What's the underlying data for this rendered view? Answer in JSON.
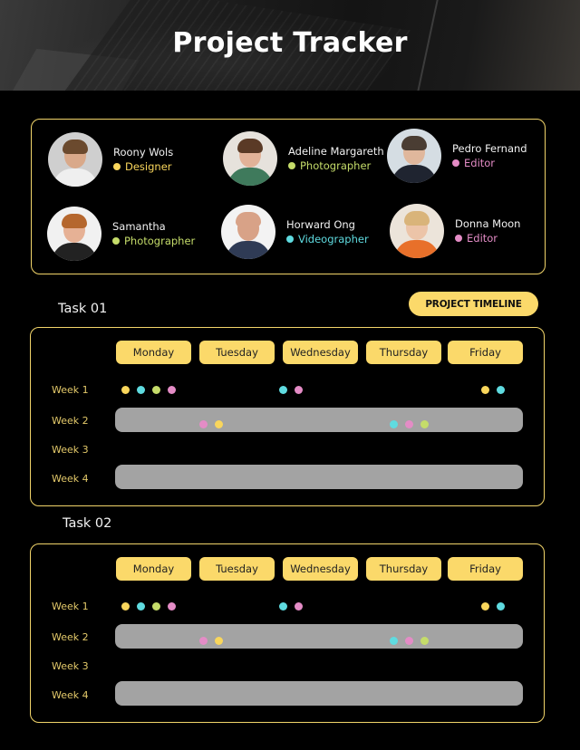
{
  "header": {
    "title": "Project Tracker"
  },
  "team": [
    {
      "name": "Roony Wols",
      "role": "Designer",
      "role_color": "#f9d65c",
      "avatar": "avatar-roony-wols"
    },
    {
      "name": "Adeline Margareth",
      "role": "Photographer",
      "role_color": "#c5dc6a",
      "avatar": "avatar-adeline-margareth"
    },
    {
      "name": "Pedro Fernand",
      "role": "Editor",
      "role_color": "#e48cc6",
      "avatar": "avatar-pedro-fernand"
    },
    {
      "name": "Samantha",
      "role": "Photographer",
      "role_color": "#c5dc6a",
      "avatar": "avatar-samantha"
    },
    {
      "name": "Horward Ong",
      "role": "Videographer",
      "role_color": "#5fdbe0",
      "avatar": "avatar-horward-ong"
    },
    {
      "name": "Donna Moon",
      "role": "Editor",
      "role_color": "#e48cc6",
      "avatar": "avatar-donna-moon"
    }
  ],
  "colors": {
    "accent": "#fbd96a",
    "border": "#f2d56a",
    "week_label": "#e3c96a",
    "bar": "#a3a3a3",
    "designer": "#f9d65c",
    "photographer": "#c5dc6a",
    "videographer": "#5fdbe0",
    "editor": "#e48cc6"
  },
  "timeline_button": "PROJECT TIMELINE",
  "days": [
    "Monday",
    "Tuesday",
    "Wednesday",
    "Thursday",
    "Friday"
  ],
  "weeks": [
    "Week 1",
    "Week 2",
    "Week 3",
    "Week 4"
  ],
  "tasks": [
    {
      "label": "Task 01",
      "bars": [
        "Week 2",
        "Week 4"
      ],
      "markers": [
        {
          "week": "Week 1",
          "day": "Monday",
          "roles": [
            "Designer",
            "Videographer",
            "Photographer",
            "Editor"
          ]
        },
        {
          "week": "Week 1",
          "day": "Wednesday",
          "roles": [
            "Videographer",
            "Editor"
          ]
        },
        {
          "week": "Week 1",
          "day": "Friday",
          "roles": [
            "Designer",
            "Videographer"
          ]
        },
        {
          "week": "Week 2",
          "day": "Tuesday",
          "roles": [
            "Editor",
            "Designer"
          ]
        },
        {
          "week": "Week 2",
          "day": "Thursday",
          "roles": [
            "Videographer",
            "Editor",
            "Photographer"
          ]
        }
      ]
    },
    {
      "label": "Task 02",
      "bars": [
        "Week 2",
        "Week 4"
      ],
      "markers": [
        {
          "week": "Week 1",
          "day": "Monday",
          "roles": [
            "Designer",
            "Videographer",
            "Photographer",
            "Editor"
          ]
        },
        {
          "week": "Week 1",
          "day": "Wednesday",
          "roles": [
            "Videographer",
            "Editor"
          ]
        },
        {
          "week": "Week 1",
          "day": "Friday",
          "roles": [
            "Designer",
            "Videographer"
          ]
        },
        {
          "week": "Week 2",
          "day": "Tuesday",
          "roles": [
            "Editor",
            "Designer"
          ]
        },
        {
          "week": "Week 2",
          "day": "Thursday",
          "roles": [
            "Videographer",
            "Editor",
            "Photographer"
          ]
        }
      ]
    }
  ]
}
